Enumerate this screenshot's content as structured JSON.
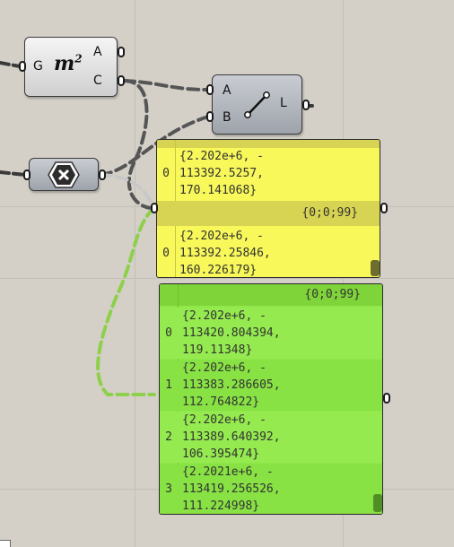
{
  "components": {
    "area": {
      "input_label": "G",
      "icon_text": "m",
      "icon_sup": "2",
      "output_a": "A",
      "output_c": "C"
    },
    "line": {
      "input_a": "A",
      "input_b": "B",
      "output_l": "L"
    },
    "cull": {
      "icon": "close-icon"
    }
  },
  "yellow_panel": {
    "color": "#f8f85a",
    "header_color": "#d8d453",
    "branches": [
      {
        "path": "",
        "items": [
          {
            "index": "0",
            "lines": [
              "{2.202e+6, -",
              "113392.5257,",
              "170.141068}"
            ]
          }
        ]
      },
      {
        "path": "{0;0;99}",
        "items": [
          {
            "index": "0",
            "lines": [
              "{2.202e+6, -",
              "113392.25846,",
              "160.226179}"
            ]
          }
        ]
      }
    ]
  },
  "green_panel": {
    "color": "#8fe84a",
    "header_color": "#7fd43a",
    "path": "{0;0;99}",
    "items": [
      {
        "index": "0",
        "lines": [
          "{2.202e+6, -",
          "113420.804394,",
          "119.11348}"
        ]
      },
      {
        "index": "1",
        "lines": [
          "{2.202e+6, -",
          "113383.286605,",
          "112.764822}"
        ]
      },
      {
        "index": "2",
        "lines": [
          "{2.202e+6, -",
          "113389.640392,",
          "106.395474}"
        ]
      },
      {
        "index": "3",
        "lines": [
          "{2.2021e+6, -",
          "113419.256526,",
          "111.224998}"
        ]
      }
    ]
  }
}
